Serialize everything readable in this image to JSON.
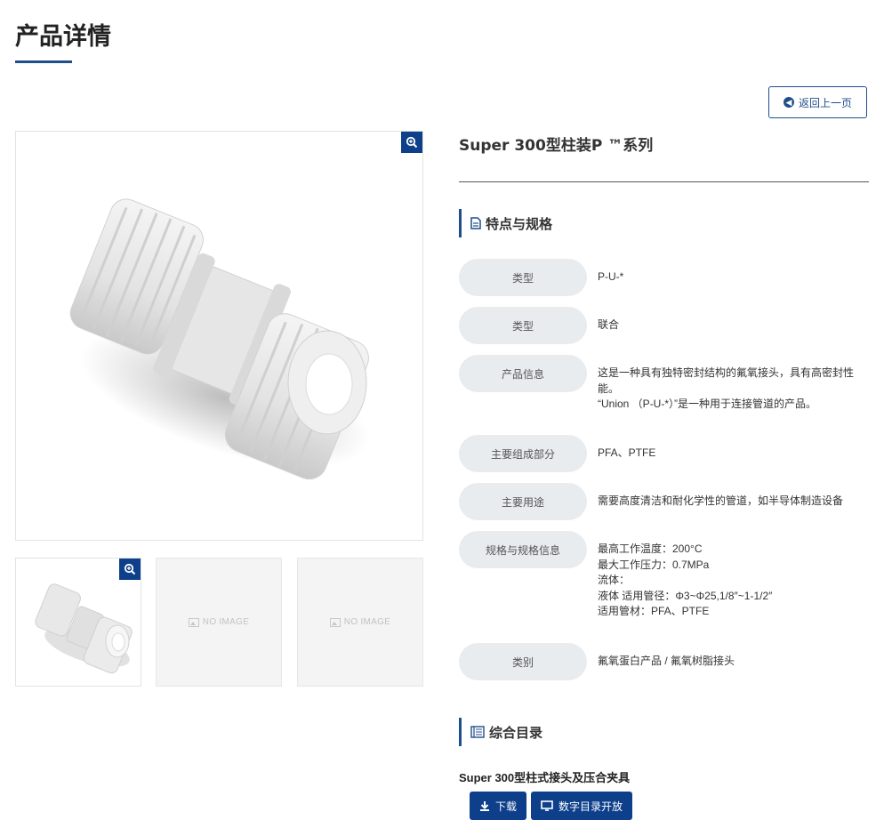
{
  "page": {
    "title": "产品详情"
  },
  "actions": {
    "back_label": "返回上一页"
  },
  "gallery": {
    "no_image_text": "NO IMAGE"
  },
  "product": {
    "name": "Super 300型柱装P ™系列"
  },
  "specs_section": {
    "title": "特点与规格"
  },
  "specs": [
    {
      "label": "类型",
      "value": [
        "P-U-*"
      ]
    },
    {
      "label": "类型",
      "value": [
        "联合"
      ]
    },
    {
      "label": "产品信息",
      "value": [
        "这是一种具有独特密封结构的氟氧接头，具有高密封性",
        "能。",
        "“Union （P-U-*）”是一种用于连接管道的产品。"
      ]
    },
    {
      "label": "主要组成部分",
      "value": [
        "PFA、PTFE"
      ]
    },
    {
      "label": "主要用途",
      "value": [
        "需要高度清洁和耐化学性的管道，如半导体制造设备"
      ]
    },
    {
      "label": "规格与规格信息",
      "value": [
        "最高工作温度：200°C",
        "最大工作压力：0.7MPa",
        "流体：",
        "液体 适用管径：Φ3~Φ25,1/8″~1-1/2″",
        "适用管材：PFA、PTFE"
      ]
    },
    {
      "label": "类别",
      "value": [
        "氟氧蛋白产品 / 氟氧树脂接头"
      ]
    }
  ],
  "catalog_section": {
    "title": "综合目录",
    "item_title": "Super 300型柱式接头及压合夹具",
    "download_label": "下载",
    "digital_label": "数字目录开放"
  },
  "colors": {
    "accent": "#1f4e8c",
    "button": "#0d3f8a",
    "label_bg": "#e9ecef"
  }
}
